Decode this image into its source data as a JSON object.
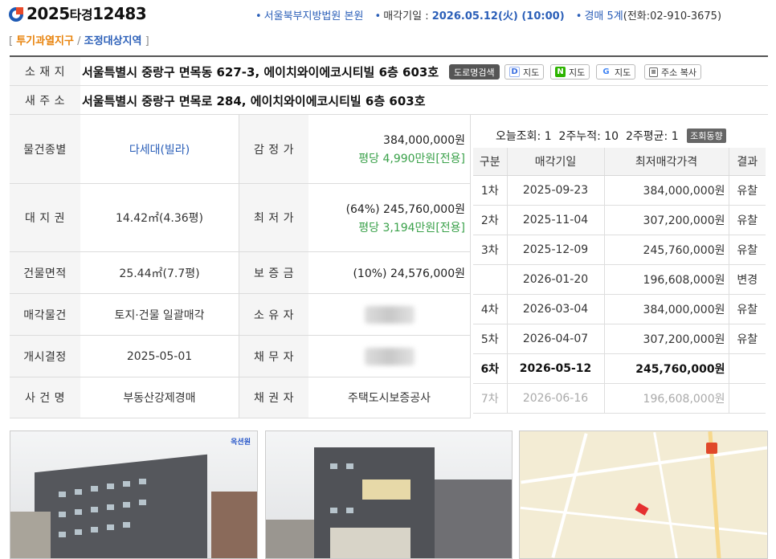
{
  "header": {
    "case_year": "2025",
    "case_kind": "타경",
    "case_num": "12483",
    "court": "서울북부지방법원 본원",
    "sale_date_label": "매각기일 :",
    "sale_date": "2026.05.12(火) (10:00)",
    "dept": "경매 5계",
    "phone": "(전화:02-910-3675)",
    "tag1": "투기과열지구",
    "tag_sep": "/",
    "tag2": "조정대상지역",
    "bracket_open": "[",
    "bracket_close": "]"
  },
  "location": {
    "label": "소 재 지",
    "address": "서울특별시 중랑구 면목동 627-3, 에이치와이에코시티빌 6층 603호",
    "btn_road": "도로명검색",
    "btn_daum": "지도",
    "btn_naver": "지도",
    "btn_google": "지도",
    "btn_copy": "주소 복사"
  },
  "new_address": {
    "label": "새 주 소",
    "address": "서울특별시 중랑구 면목로 284, 에이치와이에코시티빌 6층 603호"
  },
  "info": {
    "rows": [
      {
        "label": "물건종별",
        "value": "다세대(빌라)",
        "label2": "감 정 가",
        "value2": "384,000,000원",
        "sub2": "평당 4,990만원[전용]"
      },
      {
        "label": "대 지 권",
        "value": "14.42㎡(4.36평)",
        "label2": "최 저 가",
        "value2": "(64%) 245,760,000원",
        "sub2": "평당 3,194만원[전용]"
      },
      {
        "label": "건물면적",
        "value": "25.44㎡(7.7평)",
        "label2": "보 증 금",
        "value2": "(10%) 24,576,000원",
        "sub2": ""
      },
      {
        "label": "매각물건",
        "value": "토지·건물 일괄매각",
        "label2": "소 유 자",
        "value2": "",
        "sub2": ""
      },
      {
        "label": "개시결정",
        "value": "2025-05-01",
        "label2": "채 무 자",
        "value2": "",
        "sub2": ""
      },
      {
        "label": "사 건 명",
        "value": "부동산강제경매",
        "label2": "채 권 자",
        "value2": "주택도시보증공사",
        "sub2": ""
      }
    ]
  },
  "stats": {
    "today_label": "오늘조회:",
    "today": "1",
    "week2_label": "2주누적:",
    "week2": "10",
    "avg_label": "2주평균:",
    "avg": "1",
    "trend_btn": "조회동향"
  },
  "history": {
    "headers": [
      "구분",
      "매각기일",
      "최저매각가격",
      "결과"
    ],
    "rows": [
      {
        "round": "1차",
        "date": "2025-09-23",
        "price": "384,000,000원",
        "result": "유찰"
      },
      {
        "round": "2차",
        "date": "2025-11-04",
        "price": "307,200,000원",
        "result": "유찰"
      },
      {
        "round": "3차",
        "date": "2025-12-09",
        "price": "245,760,000원",
        "result": "유찰"
      },
      {
        "round": "",
        "date": "2026-01-20",
        "price": "196,608,000원",
        "result": "변경"
      },
      {
        "round": "4차",
        "date": "2026-03-04",
        "price": "384,000,000원",
        "result": "유찰"
      },
      {
        "round": "5차",
        "date": "2026-04-07",
        "price": "307,200,000원",
        "result": "유찰"
      },
      {
        "round": "6차",
        "date": "2026-05-12",
        "price": "245,760,000원",
        "result": ""
      },
      {
        "round": "7차",
        "date": "2026-06-16",
        "price": "196,608,000원",
        "result": ""
      }
    ]
  },
  "photos": {
    "watermark": "옥션원"
  },
  "colors": {
    "accent_blue": "#2b5fb8",
    "accent_orange": "#e8820a",
    "green": "#3aa14a"
  }
}
